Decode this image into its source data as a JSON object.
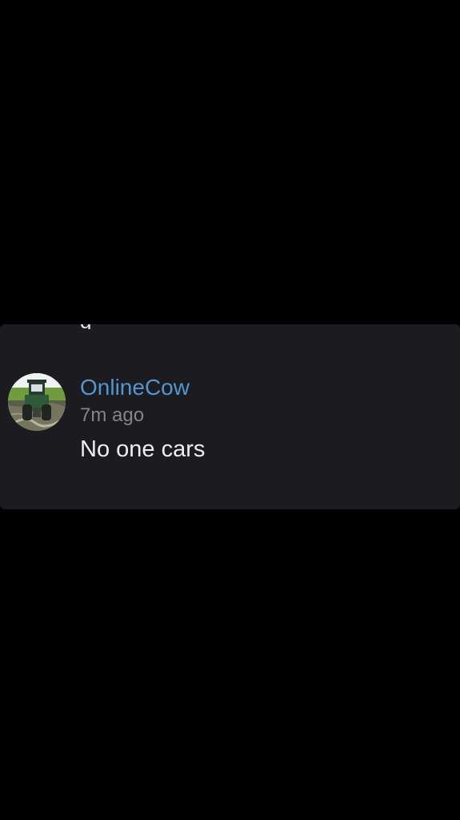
{
  "comment": {
    "previous_text_fragment": "g",
    "avatar_icon": "tractor-avatar-icon",
    "username": "OnlineCow",
    "time_ago": "7m ago",
    "message": "No one cars"
  },
  "colors": {
    "background": "#000000",
    "card_background": "#1c1b20",
    "username": "#4f97d3",
    "timestamp": "#85848a",
    "message": "#eeeef0"
  }
}
